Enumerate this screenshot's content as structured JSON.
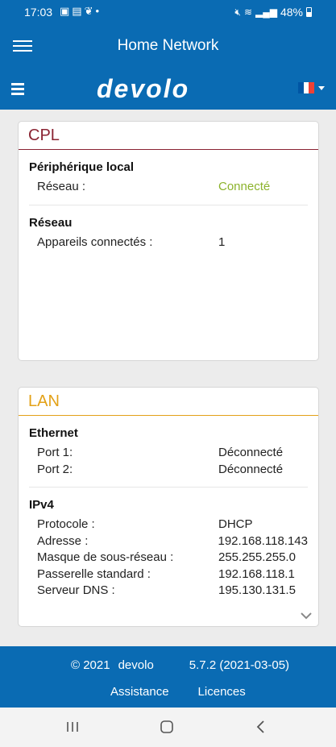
{
  "status_bar": {
    "time": "17:03",
    "left_icons": [
      "image-icon",
      "tv-icon",
      "leaf-icon",
      "dot-icon"
    ],
    "battery": "48%"
  },
  "app_bar": {
    "title": "Home Network"
  },
  "brand": {
    "logo": "devolo",
    "language": "fr",
    "colors": {
      "primary": "#0a6bb3",
      "flag_blue": "#0055a4",
      "flag_red": "#ef4135"
    }
  },
  "cpl": {
    "title": "CPL",
    "accent": "#8a2332",
    "local_device": {
      "title": "Périphérique local",
      "rows": [
        {
          "label": "Réseau :",
          "value": "Connecté",
          "value_color": "#8cb32c"
        }
      ]
    },
    "network": {
      "title": "Réseau",
      "rows": [
        {
          "label": "Appareils connectés :",
          "value": "1"
        }
      ]
    }
  },
  "lan": {
    "title": "LAN",
    "accent": "#e3a117",
    "ethernet": {
      "title": "Ethernet",
      "rows": [
        {
          "label": "Port 1:",
          "value": "Déconnecté"
        },
        {
          "label": "Port 2:",
          "value": "Déconnecté"
        }
      ]
    },
    "ipv4": {
      "title": "IPv4",
      "rows": [
        {
          "label": "Protocole :",
          "value": "DHCP"
        },
        {
          "label": "Adresse :",
          "value": "192.168.118.143"
        },
        {
          "label": "Masque de sous-réseau :",
          "value": "255.255.255.0"
        },
        {
          "label": "Passerelle standard :",
          "value": "192.168.118.1"
        },
        {
          "label": "Serveur DNS :",
          "value": "195.130.131.5"
        }
      ]
    }
  },
  "footer": {
    "copyright": "© 2021",
    "company": "devolo",
    "version": "5.7.2 (2021-03-05)",
    "links": {
      "support": "Assistance",
      "licenses": "Licences"
    }
  }
}
